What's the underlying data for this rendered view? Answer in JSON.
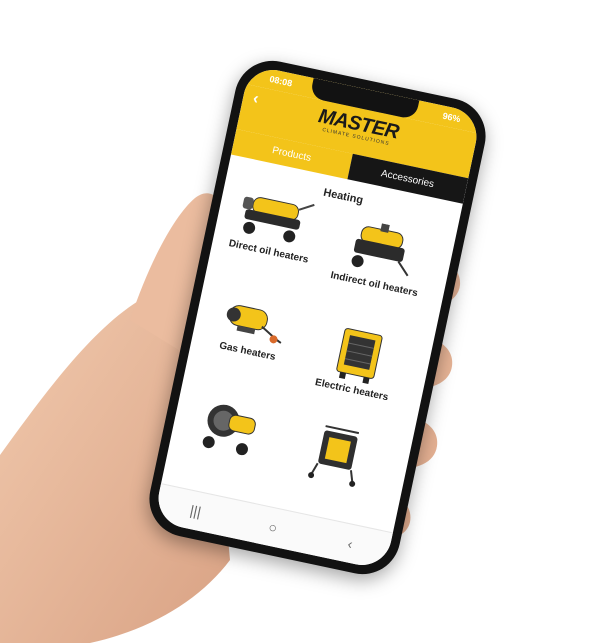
{
  "status_bar": {
    "time": "08:08",
    "battery": "96%"
  },
  "header": {
    "logo_main": "MASTER",
    "logo_sub": "CLIMATE SOLUTIONS"
  },
  "tabs": [
    {
      "label": "Products",
      "active": true
    },
    {
      "label": "Accessories",
      "active": false
    }
  ],
  "section": {
    "title": "Heating"
  },
  "products": [
    {
      "label": "Direct oil heaters",
      "icon": "direct-oil-heater-icon"
    },
    {
      "label": "Indirect oil heaters",
      "icon": "indirect-oil-heater-icon"
    },
    {
      "label": "Gas heaters",
      "icon": "gas-heater-icon"
    },
    {
      "label": "Electric heaters",
      "icon": "electric-heater-icon"
    },
    {
      "label": "",
      "icon": "radiant-heater-icon"
    },
    {
      "label": "",
      "icon": "fan-heater-icon"
    }
  ],
  "colors": {
    "brand_yellow": "#f3c41a",
    "tab_dark": "#161616"
  }
}
